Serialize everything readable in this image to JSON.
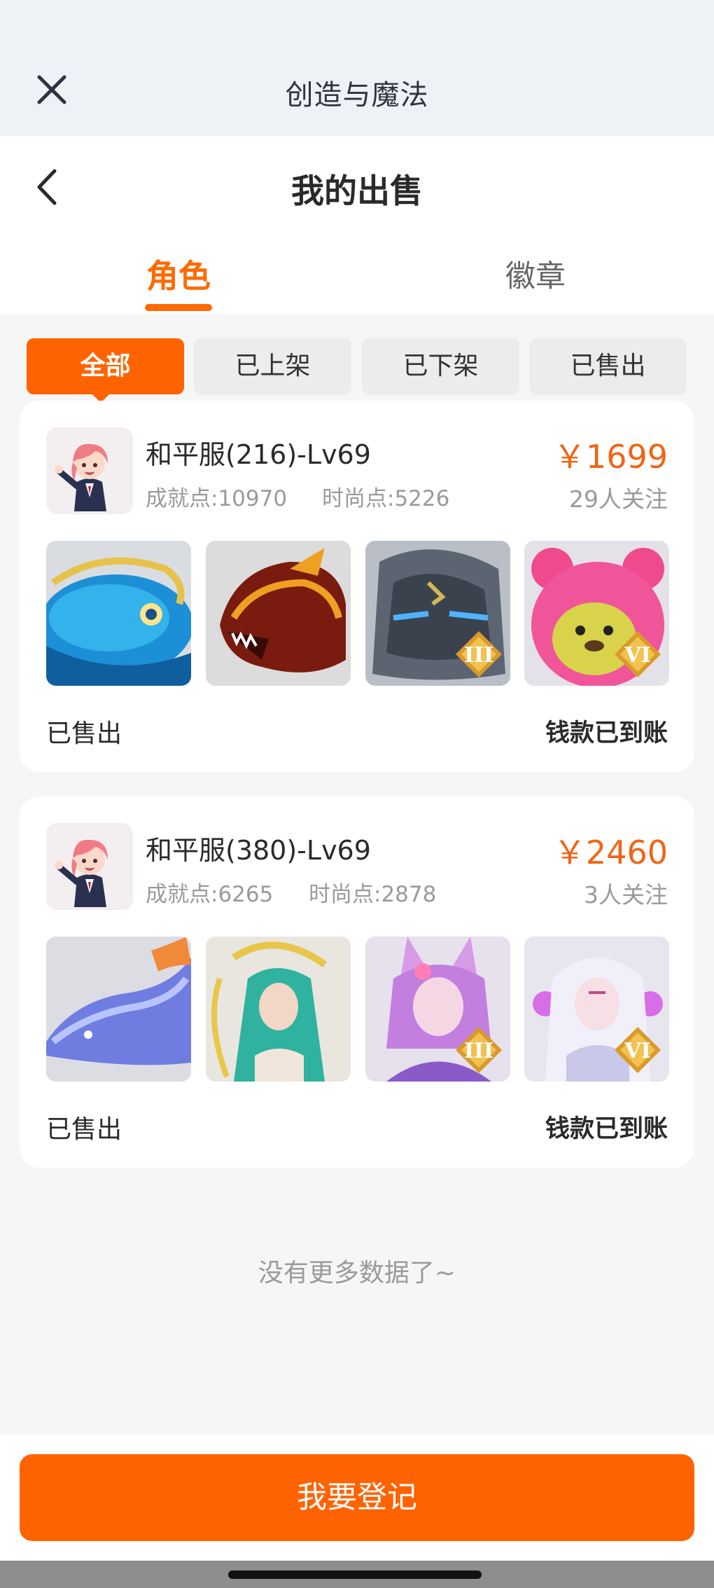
{
  "topbar": {
    "title": "创造与魔法",
    "close_icon": "close-icon"
  },
  "header": {
    "title": "我的出售",
    "back_icon": "chevron-left-icon",
    "tabs": [
      {
        "label": "角色",
        "active": true
      },
      {
        "label": "徽章",
        "active": false
      }
    ]
  },
  "filters": [
    {
      "label": "全部",
      "active": true
    },
    {
      "label": "已上架",
      "active": false
    },
    {
      "label": "已下架",
      "active": false
    },
    {
      "label": "已售出",
      "active": false
    }
  ],
  "listings": [
    {
      "name": "和平服(216)-Lv69",
      "achievement": "成就点:10970",
      "fashion": "时尚点:5226",
      "price": "￥1699",
      "followers": "29人关注",
      "thumbs": [
        {
          "icon": "blue-whale-mount-icon",
          "grade": ""
        },
        {
          "icon": "fire-dragon-mount-icon",
          "grade": ""
        },
        {
          "icon": "stone-golem-mount-icon",
          "grade": "III"
        },
        {
          "icon": "pink-bear-pet-icon",
          "grade": "VI"
        }
      ],
      "sale_status": "已售出",
      "pay_status": "钱款已到账"
    },
    {
      "name": "和平服(380)-Lv69",
      "achievement": "成就点:6265",
      "fashion": "时尚点:2878",
      "price": "￥2460",
      "followers": "3人关注",
      "thumbs": [
        {
          "icon": "ice-dragon-mount-icon",
          "grade": ""
        },
        {
          "icon": "green-hair-spirit-icon",
          "grade": ""
        },
        {
          "icon": "fox-spirit-icon",
          "grade": "III"
        },
        {
          "icon": "white-hair-spirit-icon",
          "grade": "VI"
        }
      ],
      "sale_status": "已售出",
      "pay_status": "钱款已到账"
    }
  ],
  "no_more": "没有更多数据了~",
  "primary_button": "我要登记",
  "colors": {
    "accent": "#ff6300",
    "price": "#f06514",
    "muted": "#9a9a9a"
  }
}
